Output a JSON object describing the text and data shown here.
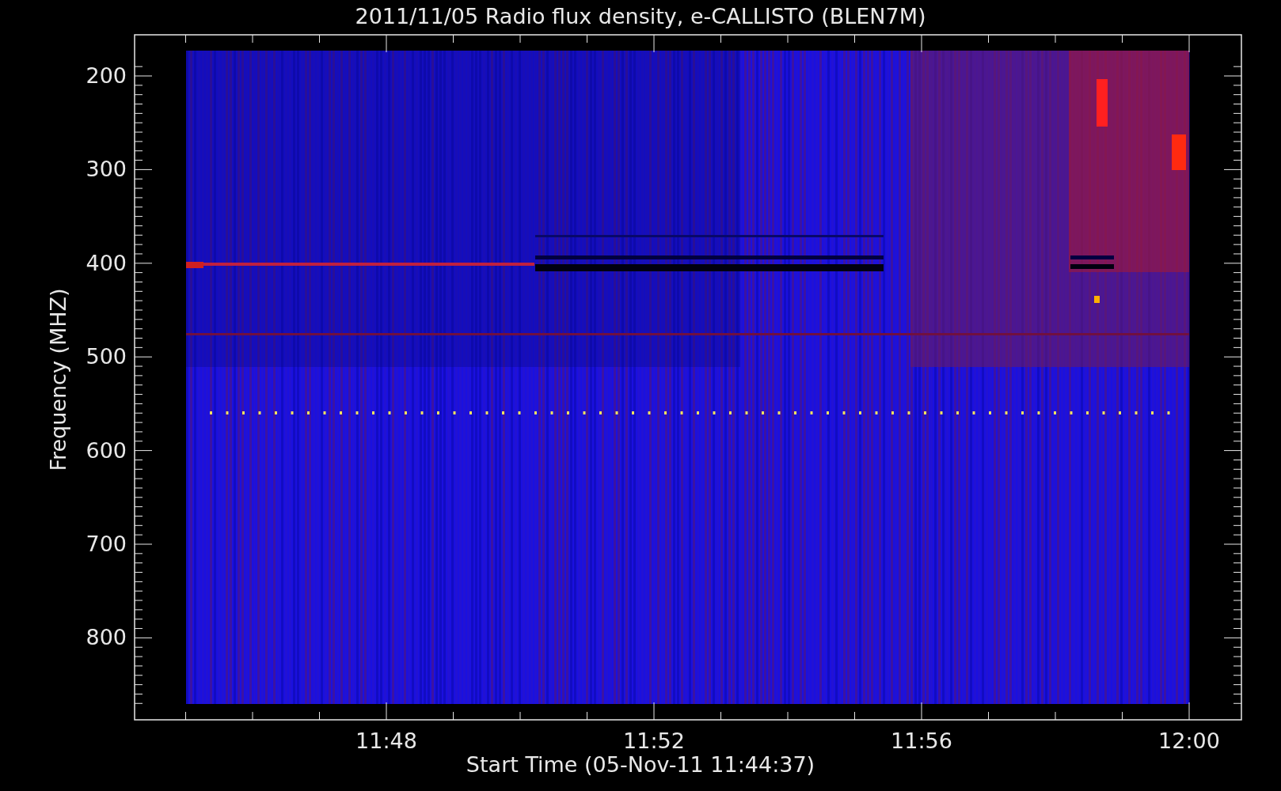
{
  "title": "2011/11/05  Radio flux density, e-CALLISTO (BLEN7M)",
  "y_axis": {
    "label": "Frequency (MHZ)",
    "ticks": [
      "200",
      "300",
      "400",
      "500",
      "600",
      "700",
      "800"
    ]
  },
  "x_axis": {
    "label": "Start Time (05-Nov-11 11:44:37)",
    "ticks": [
      "11:48",
      "11:52",
      "11:56",
      "12:00"
    ]
  }
}
